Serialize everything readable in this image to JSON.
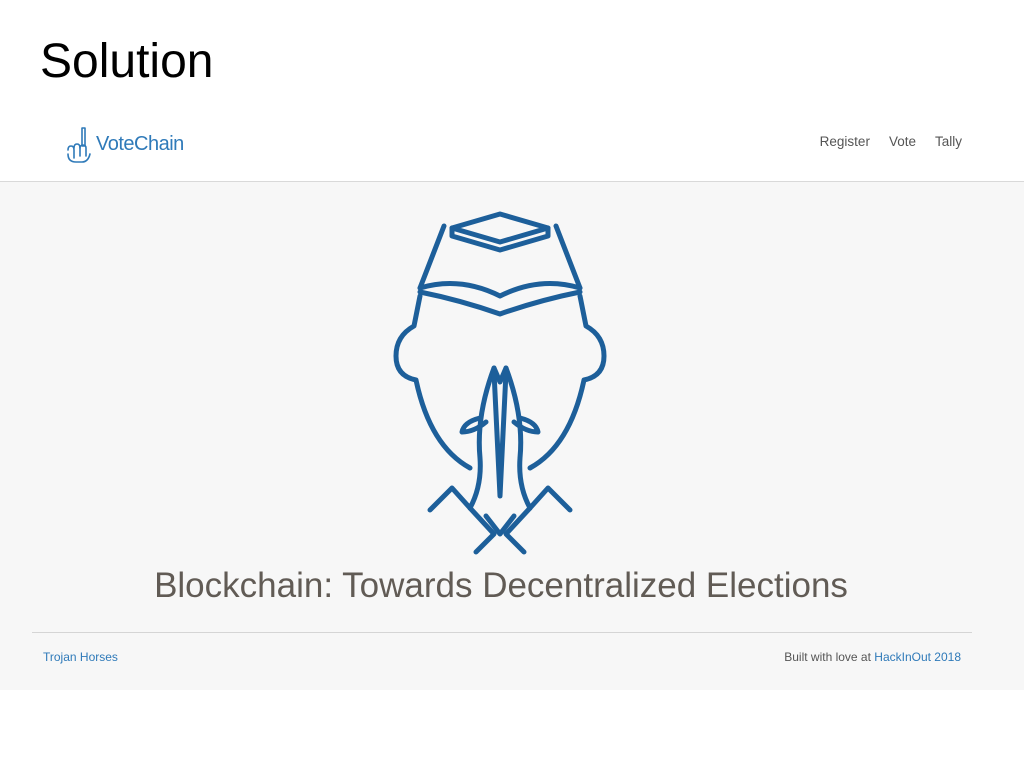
{
  "slide": {
    "title": "Solution"
  },
  "navbar": {
    "brand": {
      "icon": "vote-hand-icon",
      "text": "VoteChain"
    },
    "links": [
      "Register",
      "Vote",
      "Tally"
    ]
  },
  "hero": {
    "logo_icon": "praying-hands-icon",
    "tagline": "Blockchain: Towards Decentralized Elections"
  },
  "footer": {
    "left_link": "Trojan Horses",
    "right_prefix": "Built with love at",
    "right_link": "HackInOut 2018"
  },
  "colors": {
    "accent": "#2f7ab9",
    "logo": "#1d5f9a",
    "hero_bg": "#f7f7f7",
    "tagline": "#615b55"
  }
}
